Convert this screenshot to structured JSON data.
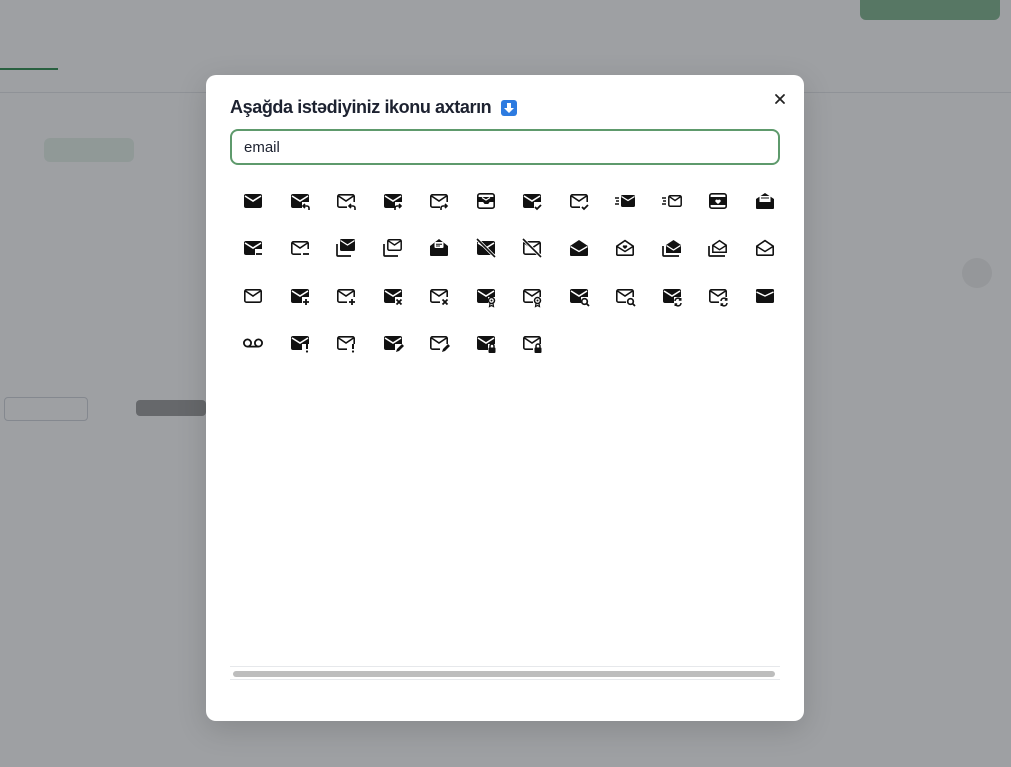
{
  "modal": {
    "title": "Aşağda istədiyiniz ikonu axtarın",
    "search_value": "email",
    "close_label": "×"
  },
  "icons": [
    {
      "name": "mail-filled-icon",
      "g": "m"
    },
    {
      "name": "mail-reply-filled-icon",
      "g": "m-reply"
    },
    {
      "name": "mail-reply-outline-icon",
      "g": "o-reply"
    },
    {
      "name": "mail-forward-filled-icon",
      "g": "m-fwd"
    },
    {
      "name": "mail-forward-outline-icon",
      "g": "o-fwd"
    },
    {
      "name": "mail-inbox-icon",
      "g": "inbox"
    },
    {
      "name": "mail-check-filled-icon",
      "g": "m-check"
    },
    {
      "name": "mail-check-outline-icon",
      "g": "o-check"
    },
    {
      "name": "mail-fast-filled-icon",
      "g": "m-fast"
    },
    {
      "name": "mail-fast-outline-icon",
      "g": "o-fast"
    },
    {
      "name": "mail-heart-icon",
      "g": "heart"
    },
    {
      "name": "mail-open-letter-icon",
      "g": "openletter"
    },
    {
      "name": "mail-minus-filled-icon",
      "g": "m-minus"
    },
    {
      "name": "mail-minus-outline-icon",
      "g": "o-minus"
    },
    {
      "name": "mail-stack-filled-icon",
      "g": "m-stack"
    },
    {
      "name": "mail-stack-outline-icon",
      "g": "o-stack"
    },
    {
      "name": "mail-message-envelope-icon",
      "g": "msgenv"
    },
    {
      "name": "mail-off-filled-icon",
      "g": "m-off"
    },
    {
      "name": "mail-off-outline-icon",
      "g": "o-off"
    },
    {
      "name": "mail-open-filled-icon",
      "g": "m-open"
    },
    {
      "name": "mail-open-heart-icon",
      "g": "openheart"
    },
    {
      "name": "mail-open-stack-filled-icon",
      "g": "m-openstack"
    },
    {
      "name": "mail-open-stack-outline-icon",
      "g": "o-openstack"
    },
    {
      "name": "mail-open-outline-icon",
      "g": "o-open"
    },
    {
      "name": "mail-outline-icon",
      "g": "o"
    },
    {
      "name": "mail-plus-filled-icon",
      "g": "m-plus"
    },
    {
      "name": "mail-plus-outline-icon",
      "g": "o-plus"
    },
    {
      "name": "mail-x-filled-icon",
      "g": "m-x"
    },
    {
      "name": "mail-x-outline-icon",
      "g": "o-x"
    },
    {
      "name": "mail-badge-filled-icon",
      "g": "m-badge"
    },
    {
      "name": "mail-badge-outline-icon",
      "g": "o-badge"
    },
    {
      "name": "mail-search-filled-icon",
      "g": "m-search"
    },
    {
      "name": "mail-search-outline-icon",
      "g": "o-search"
    },
    {
      "name": "mail-sync-filled-icon",
      "g": "m-sync"
    },
    {
      "name": "mail-sync-outline-icon",
      "g": "o-sync"
    },
    {
      "name": "mail-drafts-icon",
      "g": "m-flat"
    },
    {
      "name": "voicemail-icon",
      "g": "voicemail"
    },
    {
      "name": "mail-alert-filled-icon",
      "g": "m-alert"
    },
    {
      "name": "mail-alert-outline-icon",
      "g": "o-alert"
    },
    {
      "name": "mail-edit-filled-icon",
      "g": "m-edit"
    },
    {
      "name": "mail-edit-outline-icon",
      "g": "o-edit"
    },
    {
      "name": "mail-lock-filled-icon",
      "g": "m-lock"
    },
    {
      "name": "mail-lock-outline-icon",
      "g": "o-lock"
    }
  ],
  "background": {
    "tab_1": "",
    "tab_2": "",
    "tab_3": ""
  }
}
